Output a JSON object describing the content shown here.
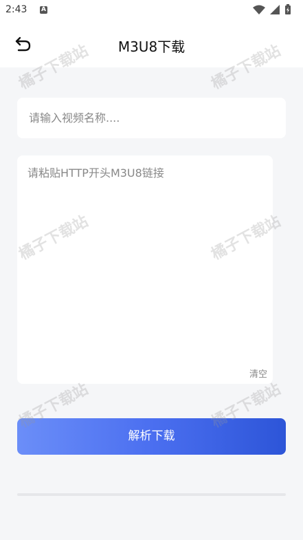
{
  "status_bar": {
    "time": "2:43",
    "notification_icon": "A",
    "icons": [
      "wifi-icon",
      "signal-icon",
      "battery-icon"
    ]
  },
  "app_bar": {
    "back_icon": "back-arrow-icon",
    "title": "M3U8下载"
  },
  "form": {
    "name_placeholder": "请输入视频名称....",
    "name_value": "",
    "url_placeholder": "请粘贴HTTP开头M3U8链接",
    "url_value": "",
    "clear_label": "清空",
    "submit_label": "解析下载"
  },
  "progress": {
    "fraction": 0
  },
  "watermark": {
    "text": "橘子下载站"
  },
  "colors": {
    "background": "#f5f6f8",
    "button_gradient_start": "#6b8ef8",
    "button_gradient_end": "#2d55d8",
    "progress_track": "#e6e7ea"
  }
}
